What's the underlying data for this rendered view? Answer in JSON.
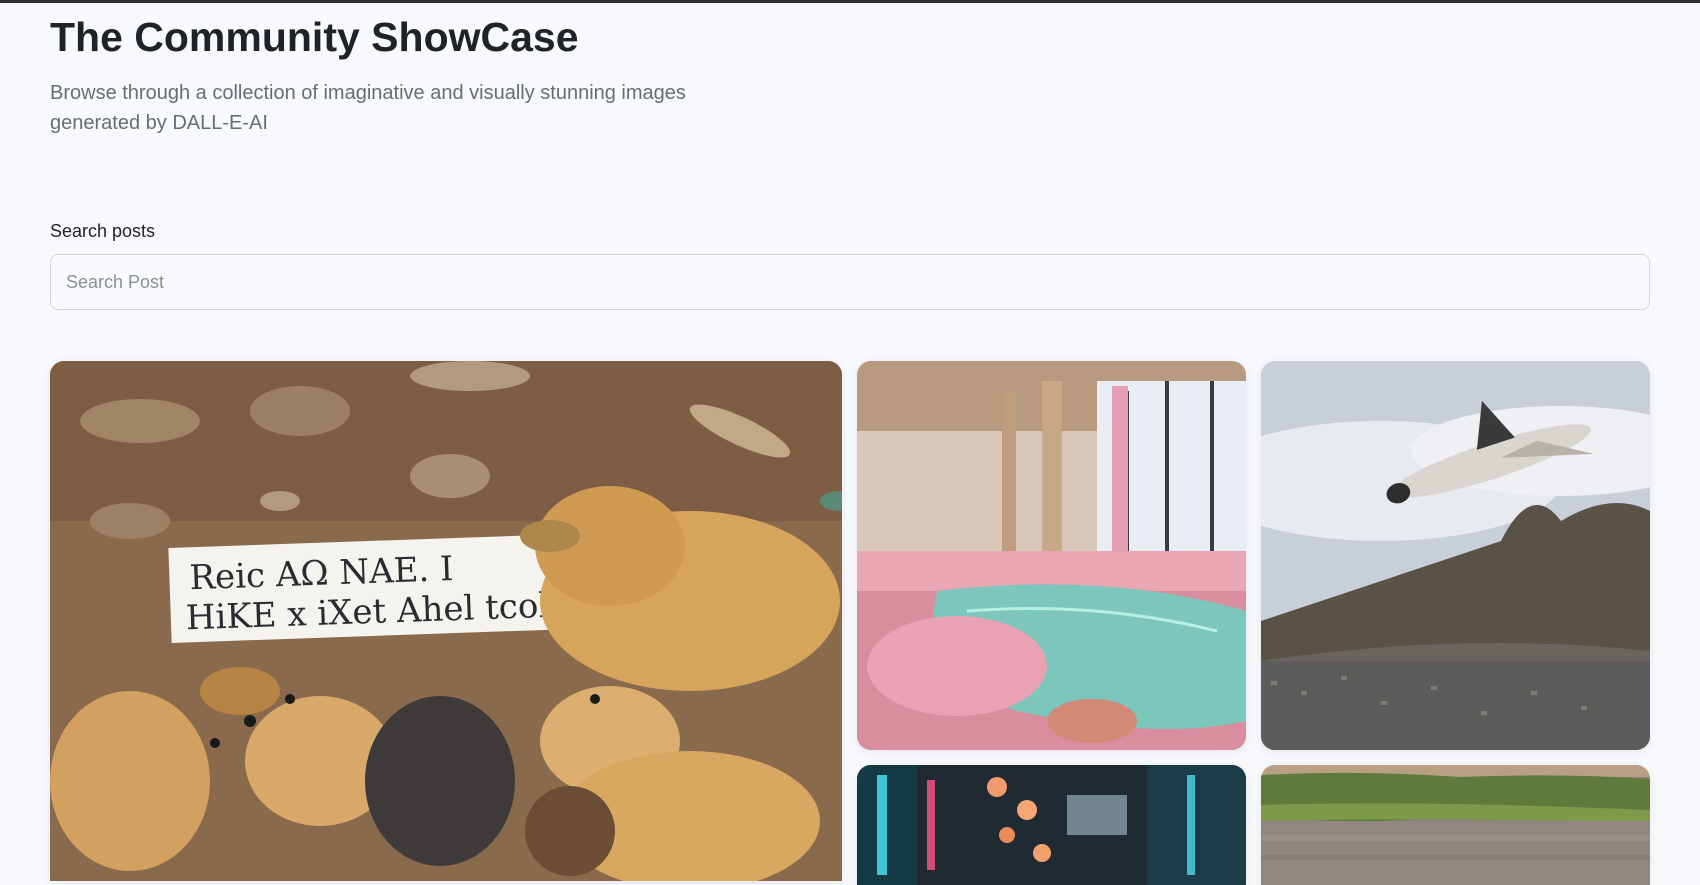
{
  "header": {
    "title": "The Community ShowCase",
    "subtitle": "Browse through a collection of imaginative and visually stunning images generated by DALL-E-AI"
  },
  "search": {
    "label": "Search posts",
    "placeholder": "Search Post",
    "value": ""
  },
  "gallery": {
    "cards": [
      {
        "subject": "puppies-with-handwritten-sign",
        "sign_text_line1": "Reic AΩ NAE. I",
        "sign_text_line2": "HiKE x iXet Ahel tcoh."
      },
      {
        "subject": "pink-lounge-indoor-pool"
      },
      {
        "subject": "space-shuttle-over-mountain-city"
      },
      {
        "subject": "neon-lantern-street"
      },
      {
        "subject": "river-with-green-bank"
      }
    ]
  },
  "colors": {
    "background": "#f8f9fd",
    "title": "#1f2226",
    "subtitle": "#666e75",
    "input_border": "#d3d6dc"
  }
}
